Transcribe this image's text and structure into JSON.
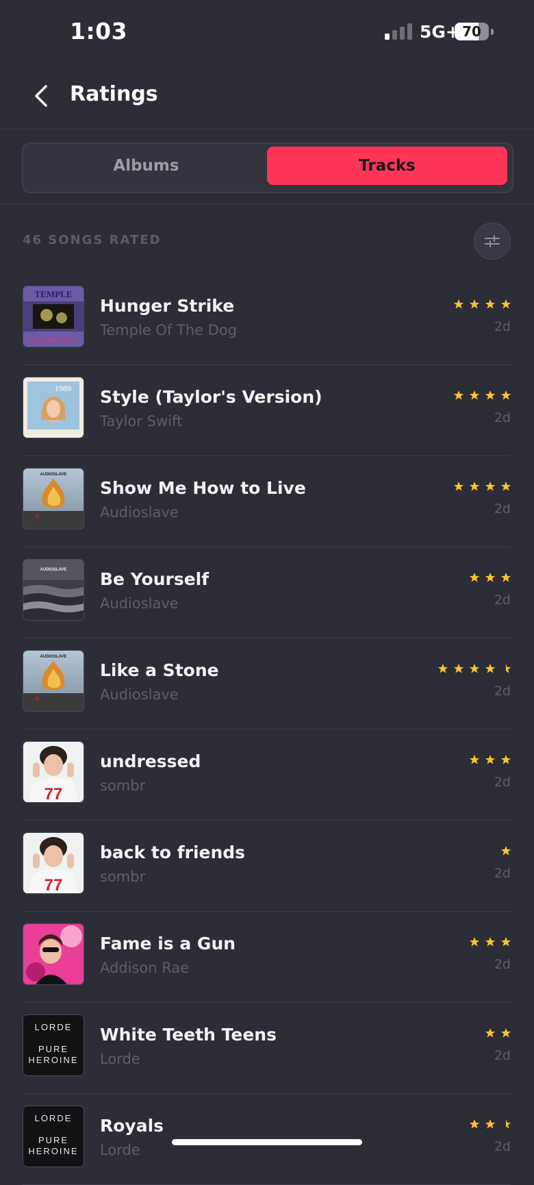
{
  "status_bar": {
    "time": "1:03",
    "network": "5G+",
    "battery": "70",
    "signal_bars_on": 1
  },
  "nav": {
    "title": "Ratings",
    "back_icon": "chevron-left-icon"
  },
  "segmented": {
    "albums_label": "Albums",
    "tracks_label": "Tracks",
    "active": "Tracks"
  },
  "list_header": {
    "count_label": "46 SONGS RATED",
    "filter_icon": "sliders-icon"
  },
  "colors": {
    "background": "#2c2d37",
    "accent": "#fe3556",
    "star": "#f9c22e",
    "muted": "#5d5e69"
  },
  "tracks": [
    {
      "title": "Hunger Strike",
      "artist": "Temple Of The Dog",
      "rating": 4,
      "time": "2d",
      "art": "temple"
    },
    {
      "title": "Style (Taylor's Version)",
      "artist": "Taylor Swift",
      "rating": 4,
      "time": "2d",
      "art": "taylor"
    },
    {
      "title": "Show Me How to Live",
      "artist": "Audioslave",
      "rating": 4,
      "time": "2d",
      "art": "audioslave"
    },
    {
      "title": "Be Yourself",
      "artist": "Audioslave",
      "rating": 3,
      "time": "2d",
      "art": "audioslave2"
    },
    {
      "title": "Like a Stone",
      "artist": "Audioslave",
      "rating": 4.5,
      "time": "2d",
      "art": "audioslave"
    },
    {
      "title": "undressed",
      "artist": "sombr",
      "rating": 3,
      "time": "2d",
      "art": "sombr"
    },
    {
      "title": "back to friends",
      "artist": "sombr",
      "rating": 1,
      "time": "2d",
      "art": "sombr"
    },
    {
      "title": "Fame is a Gun",
      "artist": "Addison Rae",
      "rating": 3,
      "time": "2d",
      "art": "addison"
    },
    {
      "title": "White Teeth Teens",
      "artist": "Lorde",
      "rating": 2,
      "time": "2d",
      "art": "lorde"
    },
    {
      "title": "Royals",
      "artist": "Lorde",
      "rating": 2.5,
      "time": "2d",
      "art": "lorde"
    }
  ],
  "album_art_text": {
    "audioslave": "AUDIOSLAVE",
    "taylor": "1989",
    "lorde_top": "LORDE",
    "lorde_mid": "PURE",
    "lorde_bot": "HEROINE",
    "temple_top": "TEMPLE",
    "temple_bot": "OF THE DOG"
  }
}
